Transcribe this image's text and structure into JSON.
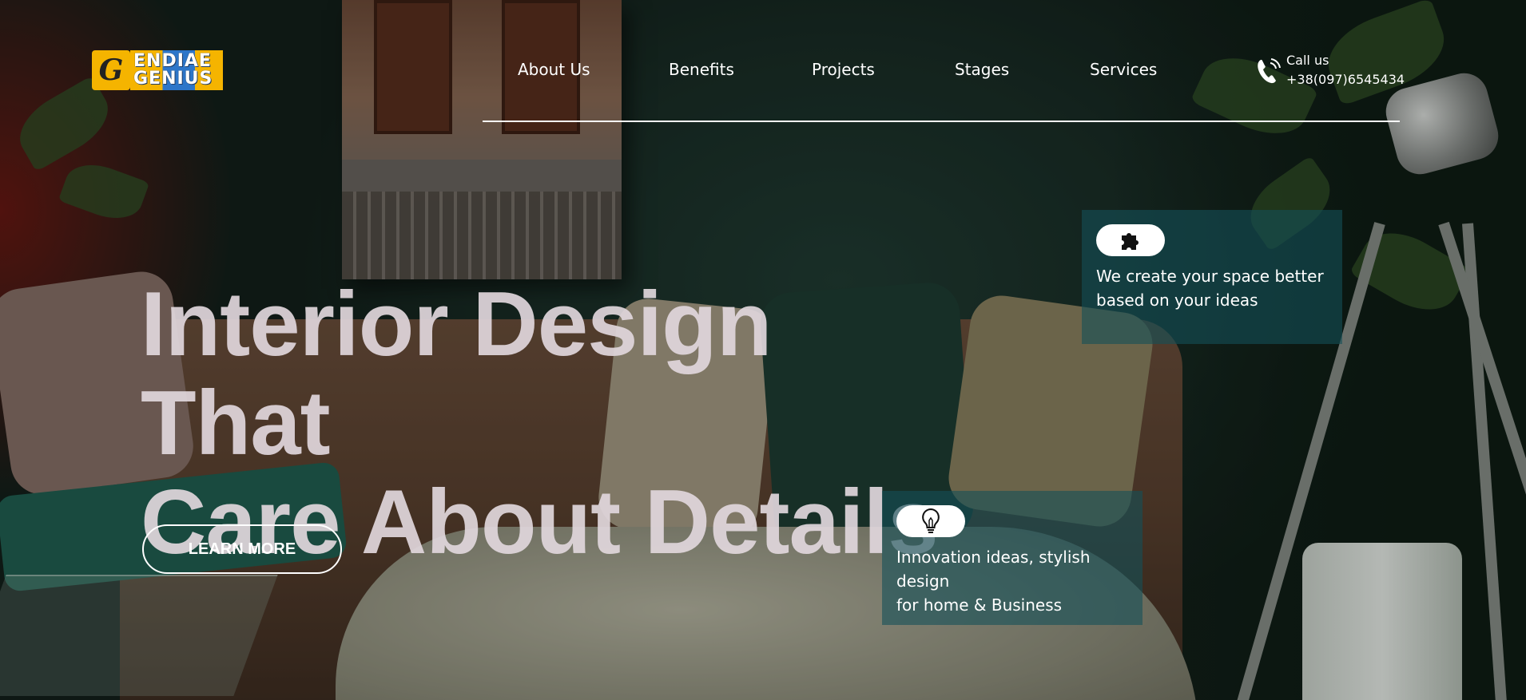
{
  "brand": {
    "logo_line1": "ENDIAE",
    "logo_line2": "GENIUS",
    "logo_mark": "G",
    "colors": {
      "yellow": "#f5b400",
      "blue": "#2d76c9"
    }
  },
  "nav": {
    "items": [
      {
        "label": "About Us"
      },
      {
        "label": "Benefits"
      },
      {
        "label": "Projects"
      },
      {
        "label": "Stages"
      },
      {
        "label": "Services"
      }
    ]
  },
  "contact": {
    "label": "Call us",
    "phone": "+38(097)6545434",
    "icon": "phone-icon"
  },
  "hero": {
    "headline_line1": "Interior Design That",
    "headline_line2": "Care About Details",
    "cta_label": "LEARN MORE"
  },
  "features": [
    {
      "icon": "puzzle-icon",
      "line1": "We create your space better",
      "line2": "based on your ideas"
    },
    {
      "icon": "lightbulb-icon",
      "line1": "Innovation ideas, stylish",
      "line2": "design",
      "line3": "for home & Business"
    }
  ],
  "theme": {
    "card_bg": "#145058",
    "text": "#ffffff"
  }
}
